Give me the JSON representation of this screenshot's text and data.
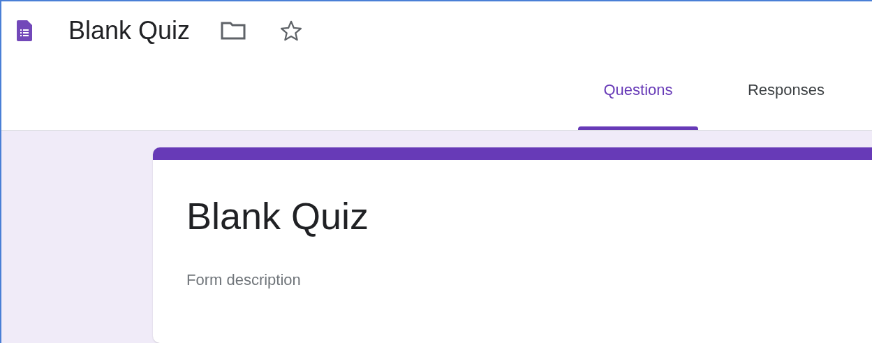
{
  "header": {
    "title": "Blank Quiz"
  },
  "tabs": [
    {
      "label": "Questions",
      "selected": true
    },
    {
      "label": "Responses",
      "selected": false
    }
  ],
  "form": {
    "title": "Blank Quiz",
    "description": {
      "placeholder": "Form description"
    }
  }
}
